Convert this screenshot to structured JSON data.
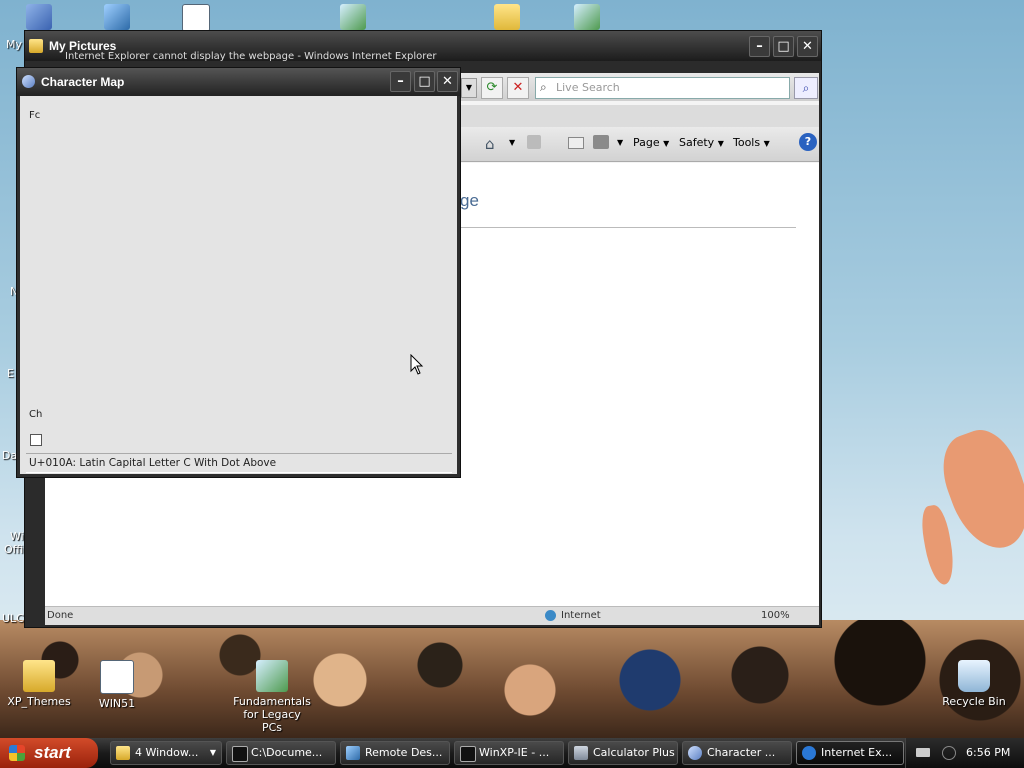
{
  "desktop": {
    "top_left_label": "My",
    "icons": [
      {
        "label": "XP_Themes"
      },
      {
        "label": "WIN51"
      },
      {
        "label": "Fundamentals for Legacy PCs"
      },
      {
        "label": "Recycle Bin"
      }
    ],
    "edge_labels": [
      "N",
      "E",
      "Da",
      "Wi",
      "Offi",
      "ULC"
    ]
  },
  "my_pictures_window": {
    "title": "My Pictures"
  },
  "ie": {
    "title_partial": "Internet Explorer cannot display the webpage - Windows Internet Explorer",
    "search_placeholder": "Live Search",
    "menus": [
      "Page",
      "Safety",
      "Tools"
    ],
    "heading_fragment": "ge",
    "status_left": "Done",
    "status_zone": "Internet",
    "status_zoom": "100%"
  },
  "charmap": {
    "title": "Character Map",
    "font_label": "Fc",
    "chars_label": "Ch",
    "status": "U+010A: Latin Capital Letter C With Dot Above"
  },
  "taskbar": {
    "start": "start",
    "tasks": [
      {
        "label": "4 Window...",
        "icon": "folder-icon"
      },
      {
        "label": "C:\\Docume...",
        "icon": "cmd-icon"
      },
      {
        "label": "Remote Des...",
        "icon": "remote-desktop-icon"
      },
      {
        "label": "WinXP-IE - ...",
        "icon": "cmd-icon"
      },
      {
        "label": "Calculator Plus",
        "icon": "calculator-icon"
      },
      {
        "label": "Character ...",
        "icon": "charmap-icon"
      },
      {
        "label": "Internet Ex...",
        "icon": "ie-icon"
      }
    ],
    "clock": "6:56 PM"
  }
}
